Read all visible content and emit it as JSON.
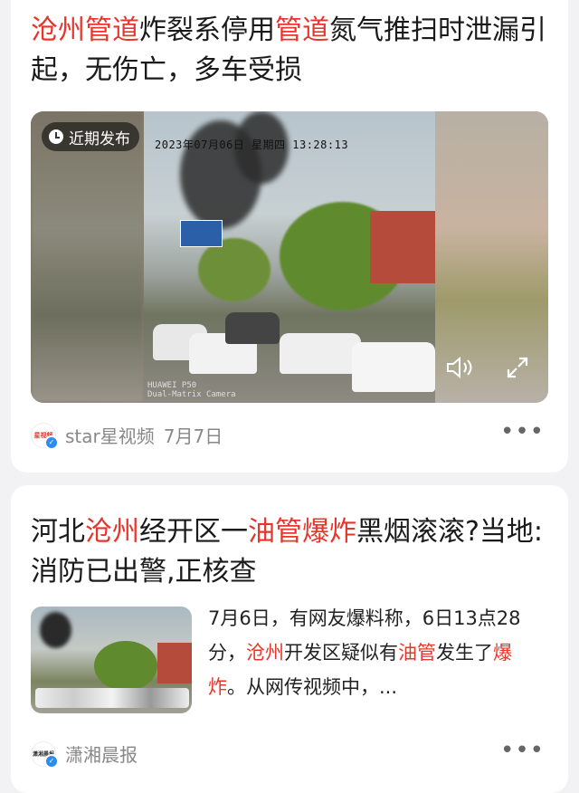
{
  "article1": {
    "title_parts": [
      {
        "text": "沧州",
        "hl": true
      },
      {
        "text": "管道",
        "hl": true
      },
      {
        "text": "炸裂系停用",
        "hl": false
      },
      {
        "text": "管道",
        "hl": true
      },
      {
        "text": "氮气推扫时泄漏引起，无伤亡，多车受损",
        "hl": false
      }
    ],
    "video": {
      "badge": "近期发布",
      "osd_timestamp": "2023年07月06日 星期四 13:28:13",
      "watermark_line1": "HUAWEI P50",
      "watermark_line2": "Dual-Matrix Camera"
    },
    "source": "star星视频",
    "date": "7月7日",
    "avatar_text": "星视频",
    "more": "•••"
  },
  "article2": {
    "title_parts": [
      {
        "text": "河北",
        "hl": false
      },
      {
        "text": "沧州",
        "hl": true
      },
      {
        "text": "经开区一",
        "hl": false
      },
      {
        "text": "油管",
        "hl": true
      },
      {
        "text": "爆炸",
        "hl": true
      },
      {
        "text": "黑烟滚滚?当地:消防已出警,正核查",
        "hl": false
      }
    ],
    "snippet_parts": [
      {
        "text": "7月6日，有网友爆料称，6日13点28分，",
        "hl": false
      },
      {
        "text": "沧州",
        "hl": true
      },
      {
        "text": "开发区疑似有",
        "hl": false
      },
      {
        "text": "油管",
        "hl": true
      },
      {
        "text": "发生了",
        "hl": false
      },
      {
        "text": "爆炸",
        "hl": true
      },
      {
        "text": "。从网传视频中，...",
        "hl": false
      }
    ],
    "source": "潇湘晨报",
    "avatar_text": "潇湘晨报",
    "more": "•••"
  },
  "colors": {
    "highlight": "#e8352b",
    "background": "#f2f2f4",
    "card": "#ffffff",
    "meta_text": "#888888",
    "verified_badge": "#2d8cf0"
  },
  "icons": {
    "clock": "clock-icon",
    "volume": "speaker-icon",
    "fullscreen": "fullscreen-icon",
    "verified": "verified-icon",
    "more": "more-icon"
  }
}
